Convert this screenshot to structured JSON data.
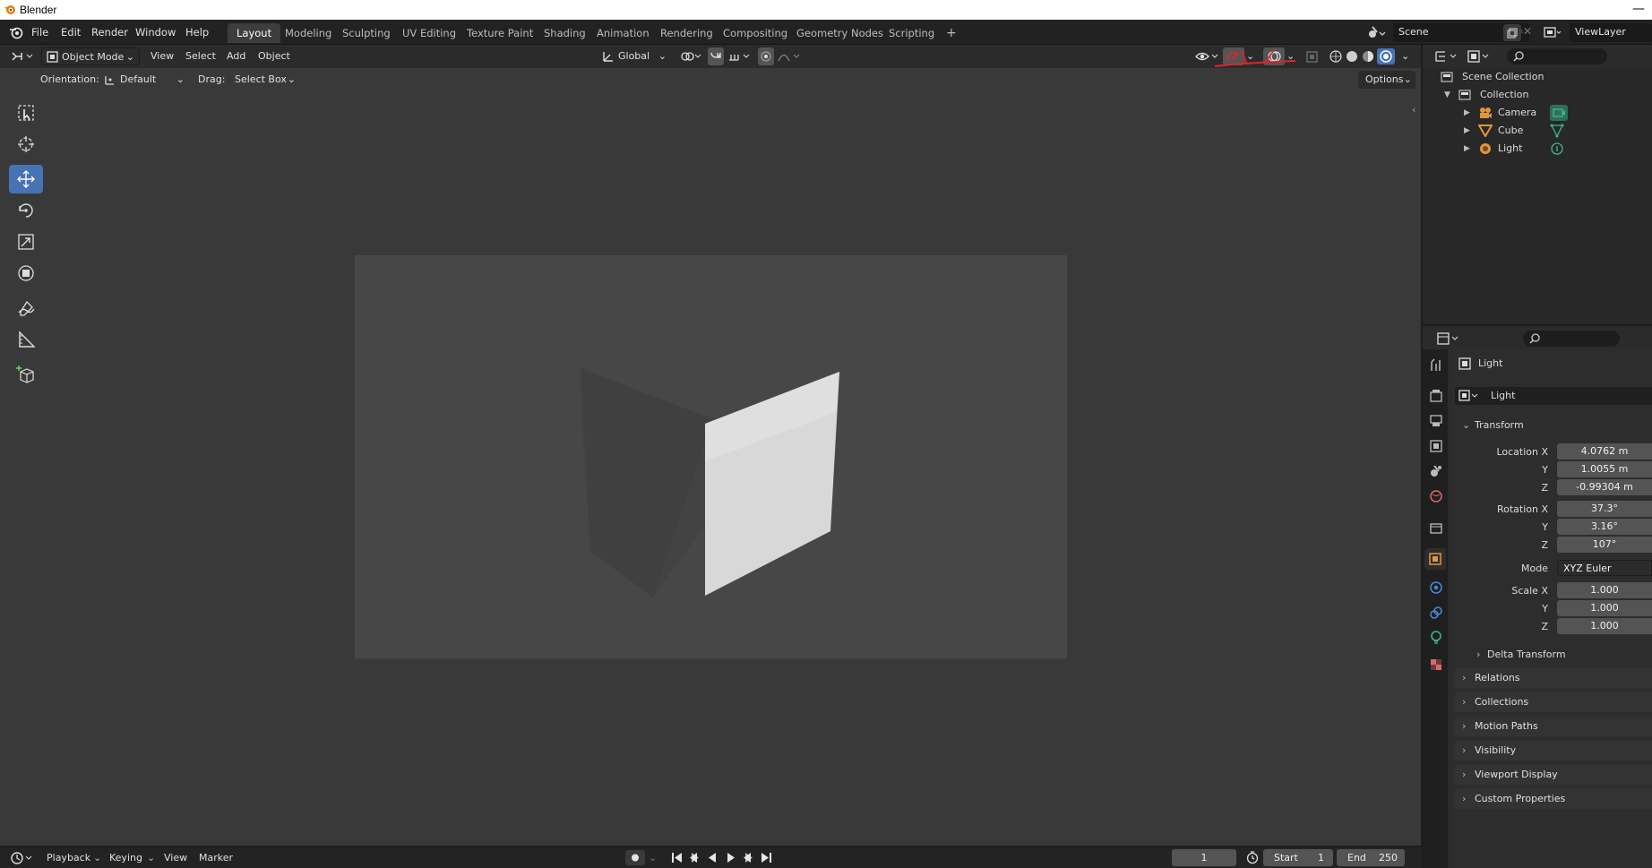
{
  "window": {
    "title": "Blender",
    "minimize": "—"
  },
  "menu": [
    "File",
    "Edit",
    "Render",
    "Window",
    "Help"
  ],
  "workspaces": [
    "Layout",
    "Modeling",
    "Sculpting",
    "UV Editing",
    "Texture Paint",
    "Shading",
    "Animation",
    "Rendering",
    "Compositing",
    "Geometry Nodes",
    "Scripting"
  ],
  "active_workspace": "Layout",
  "add_workspace": "+",
  "scene": {
    "name": "Scene",
    "view_layer": "ViewLayer"
  },
  "viewport_header": {
    "mode": "Object Mode",
    "menus": [
      "View",
      "Select",
      "Add",
      "Object"
    ],
    "transform_orientation": "Global"
  },
  "tool_settings": {
    "orientation_label": "Orientation:",
    "orientation_value": "Default",
    "drag_label": "Drag:",
    "drag_value": "Select Box",
    "options": "Options"
  },
  "outliner": {
    "root": "Scene Collection",
    "collection": "Collection",
    "objects": [
      "Camera",
      "Cube",
      "Light"
    ]
  },
  "properties": {
    "object_name": "Light",
    "datablock_name": "Light",
    "transform_title": "Transform",
    "location": {
      "label_x": "Location X",
      "label_y": "Y",
      "label_z": "Z",
      "x": "4.0762 m",
      "y": "1.0055 m",
      "z": "-0.99304 m"
    },
    "rotation": {
      "label_x": "Rotation X",
      "label_y": "Y",
      "label_z": "Z",
      "x": "37.3°",
      "y": "3.16°",
      "z": "107°"
    },
    "mode_label": "Mode",
    "mode_value": "XYZ Euler",
    "scale": {
      "label_x": "Scale X",
      "label_y": "Y",
      "label_z": "Z",
      "x": "1.000",
      "y": "1.000",
      "z": "1.000"
    },
    "delta_transform": "Delta Transform",
    "panels": [
      "Relations",
      "Collections",
      "Motion Paths",
      "Visibility",
      "Viewport Display",
      "Custom Properties"
    ]
  },
  "timeline": {
    "menus": [
      "Playback",
      "Keying",
      "View",
      "Marker"
    ],
    "current_frame": "1",
    "start_label": "Start",
    "start_value": "1",
    "end_label": "End",
    "end_value": "250"
  },
  "colors": {
    "accent": "#4772b3",
    "annotation": "#e0232d",
    "camera_obj": "#e0963c",
    "mesh_obj": "#e0963c",
    "light_data": "#3cba8b"
  }
}
